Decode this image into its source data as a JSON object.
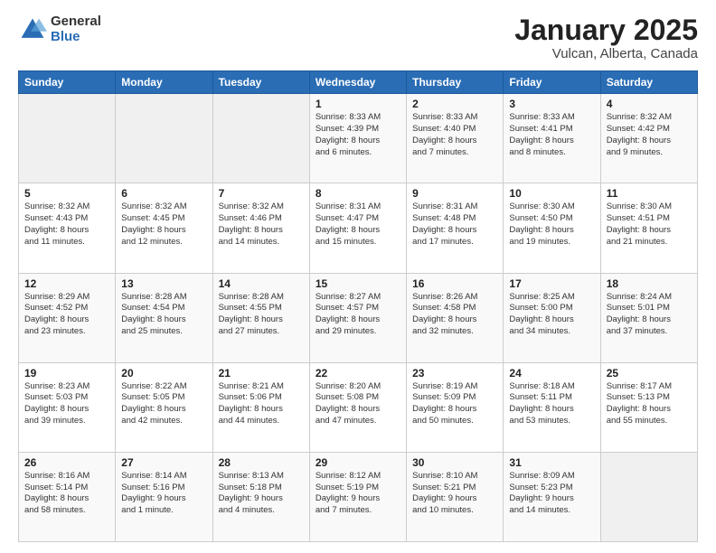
{
  "header": {
    "logo_general": "General",
    "logo_blue": "Blue",
    "month_title": "January 2025",
    "location": "Vulcan, Alberta, Canada"
  },
  "days_of_week": [
    "Sunday",
    "Monday",
    "Tuesday",
    "Wednesday",
    "Thursday",
    "Friday",
    "Saturday"
  ],
  "weeks": [
    [
      {
        "num": "",
        "detail": ""
      },
      {
        "num": "",
        "detail": ""
      },
      {
        "num": "",
        "detail": ""
      },
      {
        "num": "1",
        "detail": "Sunrise: 8:33 AM\nSunset: 4:39 PM\nDaylight: 8 hours\nand 6 minutes."
      },
      {
        "num": "2",
        "detail": "Sunrise: 8:33 AM\nSunset: 4:40 PM\nDaylight: 8 hours\nand 7 minutes."
      },
      {
        "num": "3",
        "detail": "Sunrise: 8:33 AM\nSunset: 4:41 PM\nDaylight: 8 hours\nand 8 minutes."
      },
      {
        "num": "4",
        "detail": "Sunrise: 8:32 AM\nSunset: 4:42 PM\nDaylight: 8 hours\nand 9 minutes."
      }
    ],
    [
      {
        "num": "5",
        "detail": "Sunrise: 8:32 AM\nSunset: 4:43 PM\nDaylight: 8 hours\nand 11 minutes."
      },
      {
        "num": "6",
        "detail": "Sunrise: 8:32 AM\nSunset: 4:45 PM\nDaylight: 8 hours\nand 12 minutes."
      },
      {
        "num": "7",
        "detail": "Sunrise: 8:32 AM\nSunset: 4:46 PM\nDaylight: 8 hours\nand 14 minutes."
      },
      {
        "num": "8",
        "detail": "Sunrise: 8:31 AM\nSunset: 4:47 PM\nDaylight: 8 hours\nand 15 minutes."
      },
      {
        "num": "9",
        "detail": "Sunrise: 8:31 AM\nSunset: 4:48 PM\nDaylight: 8 hours\nand 17 minutes."
      },
      {
        "num": "10",
        "detail": "Sunrise: 8:30 AM\nSunset: 4:50 PM\nDaylight: 8 hours\nand 19 minutes."
      },
      {
        "num": "11",
        "detail": "Sunrise: 8:30 AM\nSunset: 4:51 PM\nDaylight: 8 hours\nand 21 minutes."
      }
    ],
    [
      {
        "num": "12",
        "detail": "Sunrise: 8:29 AM\nSunset: 4:52 PM\nDaylight: 8 hours\nand 23 minutes."
      },
      {
        "num": "13",
        "detail": "Sunrise: 8:28 AM\nSunset: 4:54 PM\nDaylight: 8 hours\nand 25 minutes."
      },
      {
        "num": "14",
        "detail": "Sunrise: 8:28 AM\nSunset: 4:55 PM\nDaylight: 8 hours\nand 27 minutes."
      },
      {
        "num": "15",
        "detail": "Sunrise: 8:27 AM\nSunset: 4:57 PM\nDaylight: 8 hours\nand 29 minutes."
      },
      {
        "num": "16",
        "detail": "Sunrise: 8:26 AM\nSunset: 4:58 PM\nDaylight: 8 hours\nand 32 minutes."
      },
      {
        "num": "17",
        "detail": "Sunrise: 8:25 AM\nSunset: 5:00 PM\nDaylight: 8 hours\nand 34 minutes."
      },
      {
        "num": "18",
        "detail": "Sunrise: 8:24 AM\nSunset: 5:01 PM\nDaylight: 8 hours\nand 37 minutes."
      }
    ],
    [
      {
        "num": "19",
        "detail": "Sunrise: 8:23 AM\nSunset: 5:03 PM\nDaylight: 8 hours\nand 39 minutes."
      },
      {
        "num": "20",
        "detail": "Sunrise: 8:22 AM\nSunset: 5:05 PM\nDaylight: 8 hours\nand 42 minutes."
      },
      {
        "num": "21",
        "detail": "Sunrise: 8:21 AM\nSunset: 5:06 PM\nDaylight: 8 hours\nand 44 minutes."
      },
      {
        "num": "22",
        "detail": "Sunrise: 8:20 AM\nSunset: 5:08 PM\nDaylight: 8 hours\nand 47 minutes."
      },
      {
        "num": "23",
        "detail": "Sunrise: 8:19 AM\nSunset: 5:09 PM\nDaylight: 8 hours\nand 50 minutes."
      },
      {
        "num": "24",
        "detail": "Sunrise: 8:18 AM\nSunset: 5:11 PM\nDaylight: 8 hours\nand 53 minutes."
      },
      {
        "num": "25",
        "detail": "Sunrise: 8:17 AM\nSunset: 5:13 PM\nDaylight: 8 hours\nand 55 minutes."
      }
    ],
    [
      {
        "num": "26",
        "detail": "Sunrise: 8:16 AM\nSunset: 5:14 PM\nDaylight: 8 hours\nand 58 minutes."
      },
      {
        "num": "27",
        "detail": "Sunrise: 8:14 AM\nSunset: 5:16 PM\nDaylight: 9 hours\nand 1 minute."
      },
      {
        "num": "28",
        "detail": "Sunrise: 8:13 AM\nSunset: 5:18 PM\nDaylight: 9 hours\nand 4 minutes."
      },
      {
        "num": "29",
        "detail": "Sunrise: 8:12 AM\nSunset: 5:19 PM\nDaylight: 9 hours\nand 7 minutes."
      },
      {
        "num": "30",
        "detail": "Sunrise: 8:10 AM\nSunset: 5:21 PM\nDaylight: 9 hours\nand 10 minutes."
      },
      {
        "num": "31",
        "detail": "Sunrise: 8:09 AM\nSunset: 5:23 PM\nDaylight: 9 hours\nand 14 minutes."
      },
      {
        "num": "",
        "detail": ""
      }
    ]
  ]
}
